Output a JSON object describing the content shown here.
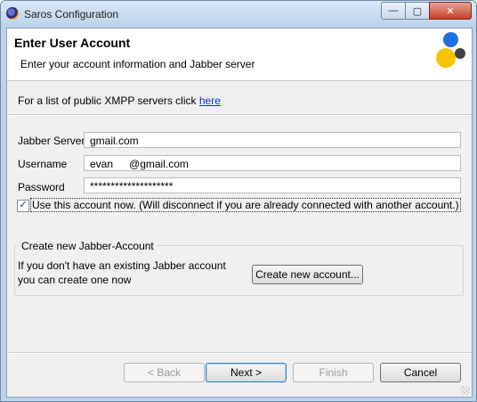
{
  "window": {
    "title": "Saros Configuration",
    "min_glyph": "—",
    "max_glyph": "▢",
    "close_glyph": "✕"
  },
  "banner": {
    "title": "Enter User Account",
    "description": "Enter your account information and Jabber server",
    "logo_colors": [
      "#1f6fe0",
      "#f6c400",
      "#404040"
    ]
  },
  "info": {
    "text": "For a list of public XMPP servers click ",
    "link": "here"
  },
  "form": {
    "server_label": "Jabber Server",
    "server_value": "gmail.com",
    "username_label": "Username",
    "username_value": "evan   @gmail.com",
    "password_label": "Password",
    "password_value": "********************"
  },
  "checkbox": {
    "checked": true,
    "mark": "✓",
    "label": "Use this account now. (Will disconnect if you are already connected with another account.)"
  },
  "group": {
    "title": "Create new Jabber-Account",
    "line1": "If you don't have an existing Jabber account",
    "line2": "you can create one now",
    "button": "Create new account..."
  },
  "buttons": {
    "back": "< Back",
    "next": "Next >",
    "finish": "Finish",
    "cancel": "Cancel"
  }
}
